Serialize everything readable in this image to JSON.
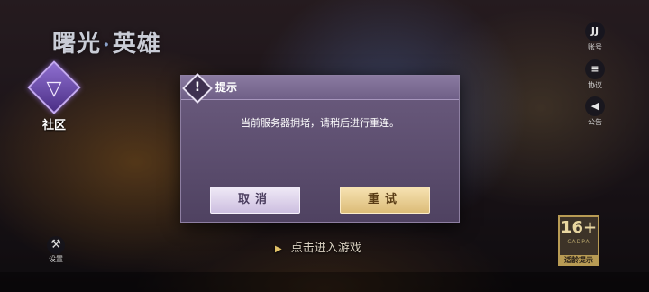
{
  "logo": {
    "left": "曙光",
    "separator": "·",
    "right": "英雄"
  },
  "community": {
    "icon": "community-triangle-icon",
    "label": "社区"
  },
  "side_buttons": [
    {
      "icon": "account-icon",
      "glyph": "JJ",
      "label": "账号"
    },
    {
      "icon": "agreement-icon",
      "glyph": "≡",
      "label": "协议"
    },
    {
      "icon": "announcement-icon",
      "glyph": "◀",
      "label": "公告"
    }
  ],
  "settings": {
    "icon": "wrench-icon",
    "label": "设置"
  },
  "age_rating": {
    "value": "16+",
    "sub": "CADPA",
    "label": "适龄提示"
  },
  "enter_game": {
    "label": "点击进入游戏"
  },
  "dialog": {
    "title": "提示",
    "icon_glyph": "!",
    "message": "当前服务器拥堵，请稍后进行重连。",
    "cancel_label": "取消",
    "retry_label": "重试"
  },
  "colors": {
    "dialog_bg": "#5e4f72",
    "cancel_bg": "#e3dbef",
    "retry_bg": "#ebd196",
    "accent": "#b89b54"
  }
}
